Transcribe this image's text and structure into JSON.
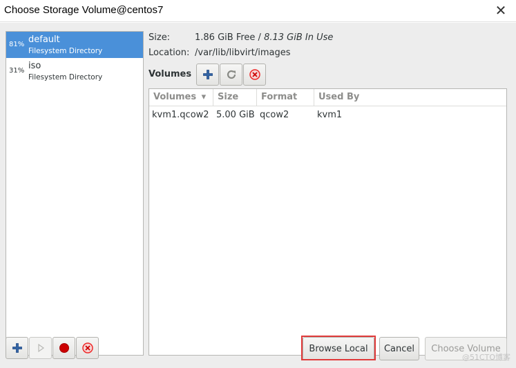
{
  "window": {
    "title": "Choose Storage Volume@centos7",
    "close_glyph": "✕"
  },
  "pools": [
    {
      "percent": "81%",
      "name": "default",
      "type": "Filesystem Directory",
      "selected": true
    },
    {
      "percent": "31%",
      "name": "iso",
      "type": "Filesystem Directory",
      "selected": false
    }
  ],
  "pool_details": {
    "size_label": "Size:",
    "size_free": "1.86 GiB Free",
    "size_separator": " / ",
    "size_in_use": "8.13 GiB In Use",
    "location_label": "Location:",
    "location_value": "/var/lib/libvirt/images"
  },
  "volumes": {
    "heading": "Volumes",
    "toolbar_icons": [
      "add-icon",
      "refresh-icon",
      "delete-icon"
    ],
    "columns": [
      "Volumes",
      "Size",
      "Format",
      "Used By"
    ],
    "sort_indicator": "▾",
    "rows": [
      {
        "name": "kvm1.qcow2",
        "size": "5.00 GiB",
        "format": "qcow2",
        "used_by": "kvm1"
      }
    ]
  },
  "pool_toolbar_icons": [
    "add-icon",
    "play-icon",
    "record-icon",
    "delete-icon"
  ],
  "buttons": {
    "browse_local": "Browse Local",
    "cancel": "Cancel",
    "choose_volume": "Choose Volume"
  },
  "watermark": "@51CTO博客",
  "colors": {
    "selection": "#4a90d9",
    "highlight": "#e03a3a",
    "add_icon": "#3465a4",
    "record_icon": "#cc0000"
  }
}
